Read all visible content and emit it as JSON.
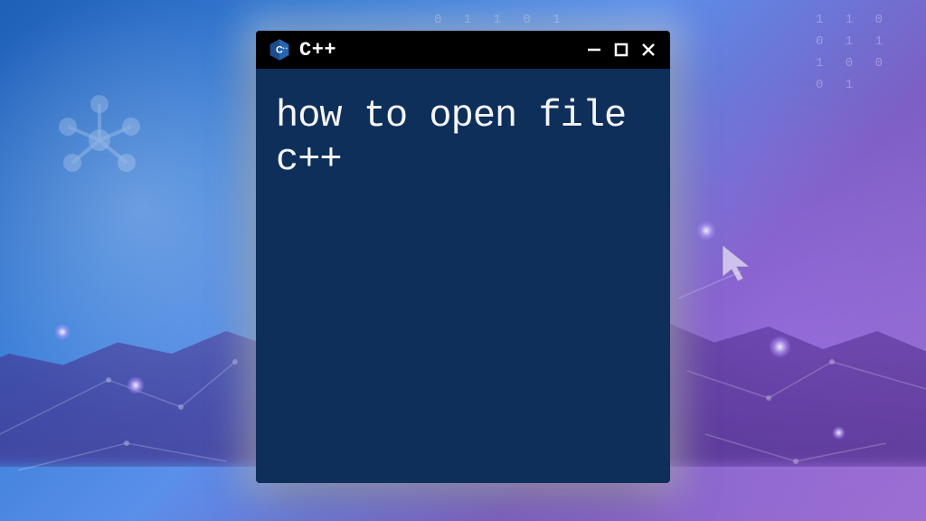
{
  "window": {
    "title": "C++",
    "icon_name": "cpp-logo-icon"
  },
  "content": {
    "text": "how to open file c++"
  },
  "colors": {
    "titlebar_bg": "#000000",
    "content_bg": "#0e2f5a",
    "content_text": "#f5f5f5"
  }
}
